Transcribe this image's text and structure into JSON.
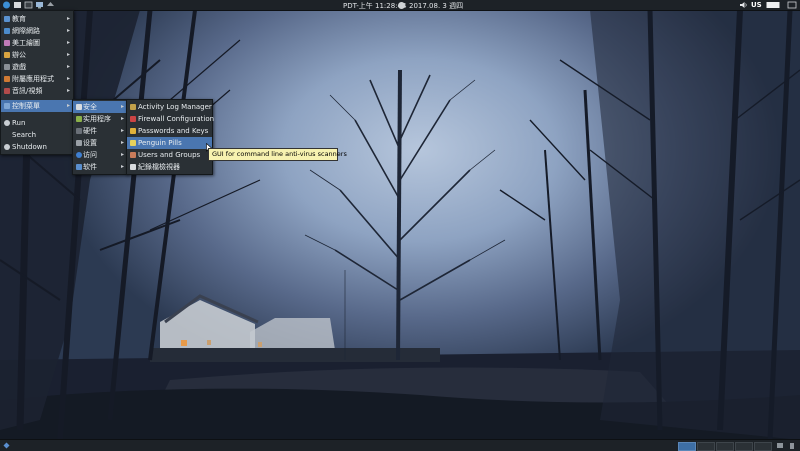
{
  "top_panel": {
    "clock": "PDT-上午 11:28:44",
    "date": "2017.08. 3 週四",
    "keyboard_layout": "US",
    "launcher_icons": [
      "app-menu-icon",
      "file-manager-icon",
      "terminal-icon",
      "display-icon",
      "folder-icon",
      "update-icon"
    ],
    "tray_icons": [
      "volume-icon",
      "keyboard-icon",
      "window-icon"
    ]
  },
  "main_menu": {
    "items": [
      {
        "label": "教育",
        "icon": "education-icon",
        "has_submenu": true
      },
      {
        "label": "網際網路",
        "icon": "internet-icon",
        "has_submenu": true
      },
      {
        "label": "美工繪圖",
        "icon": "graphics-icon",
        "has_submenu": true
      },
      {
        "label": "辦公",
        "icon": "office-icon",
        "has_submenu": true
      },
      {
        "label": "遊戲",
        "icon": "games-icon",
        "has_submenu": true
      },
      {
        "label": "附屬應用程式",
        "icon": "accessories-icon",
        "has_submenu": true
      },
      {
        "label": "音訊/視頻",
        "icon": "multimedia-icon",
        "has_submenu": true
      },
      {
        "label": "控制菜單",
        "icon": "control-menu-icon",
        "has_submenu": true,
        "selected": true
      },
      {
        "label": "Run",
        "icon": "run-icon",
        "has_submenu": false
      },
      {
        "label": "Search",
        "icon": "search-icon",
        "has_submenu": false
      },
      {
        "label": "Shutdown",
        "icon": "shutdown-icon",
        "has_submenu": false
      }
    ]
  },
  "control_submenu": {
    "items": [
      {
        "label": "安全",
        "icon": "security-icon",
        "selected": true
      },
      {
        "label": "实用程序",
        "icon": "utilities-icon"
      },
      {
        "label": "硬件",
        "icon": "hardware-icon"
      },
      {
        "label": "设置",
        "icon": "settings-icon"
      },
      {
        "label": "访问",
        "icon": "accessibility-icon"
      },
      {
        "label": "软件",
        "icon": "software-icon"
      }
    ]
  },
  "security_submenu": {
    "items": [
      {
        "label": "Activity Log Manager",
        "icon": "lock-icon"
      },
      {
        "label": "Firewall Configuration",
        "icon": "firewall-icon"
      },
      {
        "label": "Passwords and Keys",
        "icon": "key-icon"
      },
      {
        "label": "Penguin Pills",
        "icon": "penguin-pills-icon",
        "selected": true
      },
      {
        "label": "Users and Groups",
        "icon": "users-icon"
      },
      {
        "label": "紀錄檔檢視器",
        "icon": "log-viewer-icon"
      }
    ]
  },
  "tooltip": {
    "text": "GUI for command line anti-virus scanners"
  },
  "colors": {
    "panel": "#1d2227",
    "menu_bg": "#2a3035",
    "selection": "#4a76b0",
    "tooltip_bg": "#f7f2b0"
  }
}
